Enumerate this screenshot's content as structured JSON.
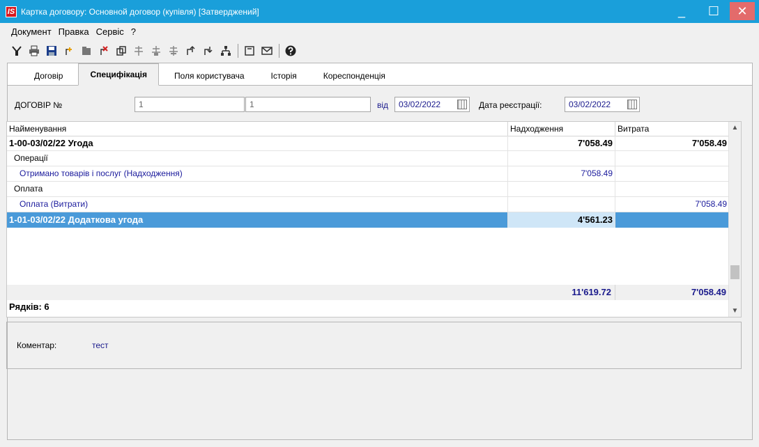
{
  "window": {
    "app_logo": "IS",
    "title": "Картка договору: Основной договор (купівля) [Затверджений]",
    "minimize_glyph": "_",
    "maximize_glyph": "☐",
    "close_glyph": "✕"
  },
  "menu": [
    "Документ",
    "Правка",
    "Сервіс",
    "?"
  ],
  "toolbar": {
    "icons": [
      "filter-icon",
      "print-icon",
      "save-icon",
      "add-icon",
      "folder-icon",
      "delete-icon",
      "copy-icon",
      "tree-icon",
      "tree-add-icon",
      "tree-remove-icon",
      "move-up-icon",
      "move-down-icon",
      "structure-icon",
      "form-icon",
      "mail-icon",
      "help-icon"
    ]
  },
  "tabs": [
    {
      "label": "Договір",
      "active": false
    },
    {
      "label": "Специфікація",
      "active": true
    },
    {
      "label": "Поля користувача",
      "active": false
    },
    {
      "label": "Історія",
      "active": false
    },
    {
      "label": "Кореспонденція",
      "active": false
    }
  ],
  "form": {
    "contract_label": "ДОГОВІР №",
    "contract_no_1": "1",
    "contract_no_2": "1",
    "from_label": "від",
    "from_date": "03/02/2022",
    "reg_label": "Дата реєстрації:",
    "reg_date": "03/02/2022"
  },
  "grid": {
    "columns": [
      "Найменування",
      "Надходження",
      "Витрата"
    ],
    "rows": [
      {
        "name": "1-00-03/02/22 Угода",
        "income": "7'058.49",
        "expense": "7'058.49",
        "style": "bold"
      },
      {
        "name": "Операції",
        "income": "",
        "expense": "",
        "style": "group"
      },
      {
        "name": "Отримано товарів і послуг (Надходження)",
        "income": "7'058.49",
        "expense": "",
        "style": "blue"
      },
      {
        "name": "Оплата",
        "income": "",
        "expense": "",
        "style": "group"
      },
      {
        "name": "Оплата (Витрати)",
        "income": "",
        "expense": "7'058.49",
        "style": "blue"
      },
      {
        "name": "1-01-03/02/22 Додаткова угода",
        "income": "4'561.23",
        "expense": "",
        "style": "bold selected"
      }
    ],
    "total_income": "11'619.72",
    "total_expense": "7'058.49",
    "rows_count": "Рядків: 6"
  },
  "comment": {
    "label": "Коментар:",
    "value": "тест"
  }
}
